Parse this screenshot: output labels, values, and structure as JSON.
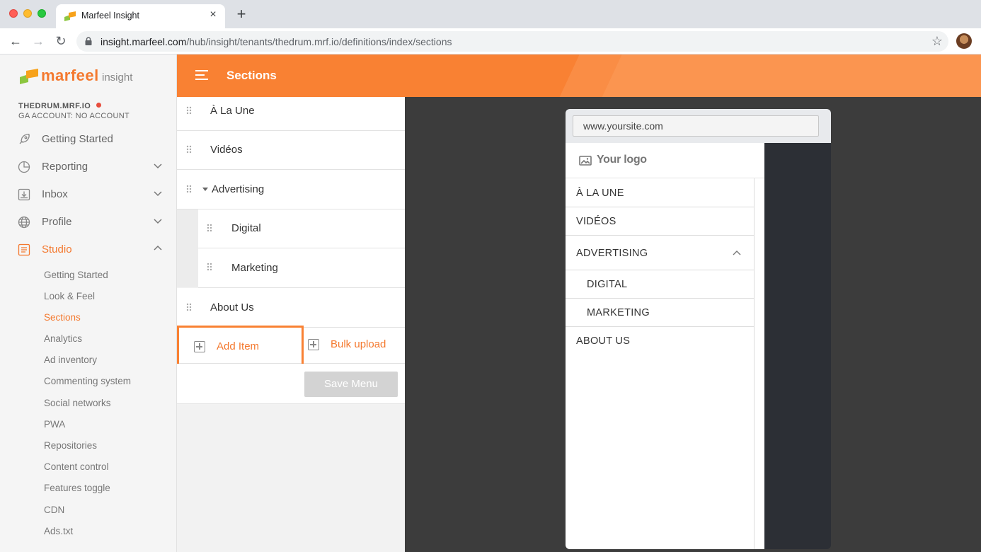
{
  "browser": {
    "tab_title": "Marfeel Insight",
    "tab_close": "×",
    "new_tab": "+",
    "url_host": "insight.marfeel.com",
    "url_path": "/hub/insight/tenants/thedrum.mrf.io/definitions/index/sections",
    "back": "←",
    "forward": "→",
    "reload": "↻",
    "bookmark": "☆"
  },
  "sidebar": {
    "brand_name": "marfeel",
    "brand_product": "insight",
    "tenant": "THEDRUM.MRF.IO",
    "ga_account": "GA ACCOUNT: NO ACCOUNT",
    "menu": [
      {
        "label": "Getting Started",
        "icon": "rocket-icon"
      },
      {
        "label": "Reporting",
        "icon": "pie-chart-icon"
      },
      {
        "label": "Inbox",
        "icon": "inbox-icon"
      },
      {
        "label": "Profile",
        "icon": "globe-icon"
      },
      {
        "label": "Studio",
        "icon": "studio-icon"
      }
    ],
    "studio_items": [
      "Getting Started",
      "Look & Feel",
      "Sections",
      "Analytics",
      "Ad inventory",
      "Commenting system",
      "Social networks",
      "PWA",
      "Repositories",
      "Content control",
      "Features toggle",
      "CDN",
      "Ads.txt"
    ]
  },
  "header": {
    "title": "Sections"
  },
  "sections": {
    "items": [
      "À La Une",
      "Vidéos",
      "Advertising",
      "Digital",
      "Marketing",
      "About Us"
    ],
    "add_item": "Add Item",
    "bulk_upload": "Bulk upload",
    "save_menu": "Save Menu"
  },
  "preview": {
    "url": "www.yoursite.com",
    "logo": "Your logo",
    "menu": [
      "À LA UNE",
      "VIDÉOS",
      "ADVERTISING",
      "DIGITAL",
      "MARKETING",
      "ABOUT US"
    ]
  },
  "colors": {
    "accent": "#f98133",
    "sidebar_bg": "#f5f5f5",
    "preview_bg": "#3c3c3c"
  }
}
